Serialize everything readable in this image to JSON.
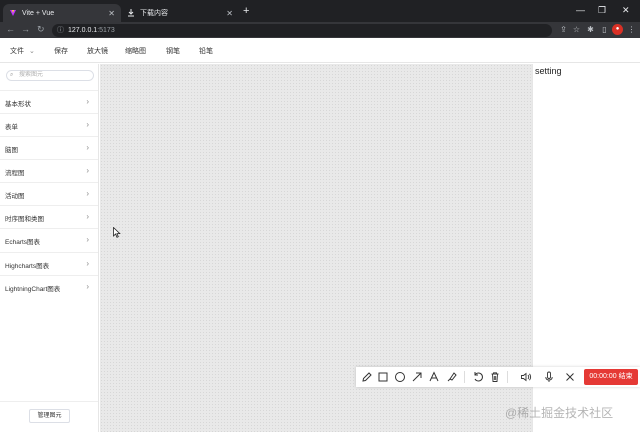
{
  "browser": {
    "tabs": [
      {
        "title": "Vite + Vue",
        "active": true
      },
      {
        "title": "下载内容",
        "active": false
      }
    ],
    "new_tab_symbol": "+",
    "window_controls": [
      "—",
      "❐",
      "✕"
    ],
    "address": {
      "host": "127.0.0.1",
      "port": ":5173"
    },
    "nav_icons": [
      "back-arrow-icon",
      "forward-arrow-icon",
      "reload-icon"
    ],
    "toolbar_icons": [
      "extensions-icon",
      "bookmark-star-icon",
      "puzzle-icon",
      "sidebar-icon",
      "profile-icon",
      "menu-dots-icon"
    ]
  },
  "menubar": {
    "file": "文件",
    "file_caret": "⌄",
    "save": "保存",
    "magnifier": "放大镜",
    "thumbnail": "缩略图",
    "pen": "钢笔",
    "pencil": "铅笔"
  },
  "sidebar": {
    "search_placeholder": "搜索图元",
    "categories": [
      {
        "label": "基本形状"
      },
      {
        "label": "表单"
      },
      {
        "label": "脑图"
      },
      {
        "label": "流程图"
      },
      {
        "label": "活动图"
      },
      {
        "label": "时序图和类图"
      },
      {
        "label": "Echarts图表"
      },
      {
        "label": "Highcharts图表"
      },
      {
        "label": "LightningChart图表"
      }
    ],
    "manage_button": "管理图元"
  },
  "settings": {
    "title": "setting"
  },
  "recorder": {
    "tools": [
      "pencil-icon",
      "square-icon",
      "circle-icon",
      "arrow-icon",
      "text-icon",
      "highlighter-icon",
      "undo-icon",
      "trash-icon",
      "speaker-icon",
      "microphone-icon",
      "close-icon"
    ],
    "timer": "00:00:00",
    "stop_label": "结束",
    "stop_color": "#e53935"
  },
  "watermark": "@稀土掘金技术社区",
  "colors": {
    "chrome_dark": "#202124",
    "chrome_tab": "#35363a",
    "canvas_bg": "#e9e9e9"
  }
}
